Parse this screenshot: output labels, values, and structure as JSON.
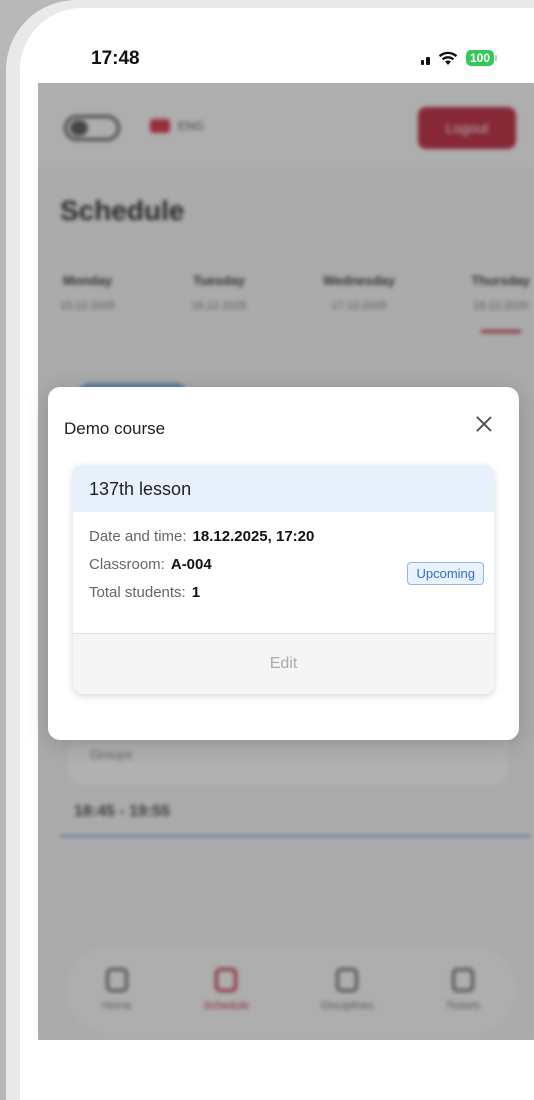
{
  "status_bar": {
    "time": "17:48",
    "battery": "100"
  },
  "background_app": {
    "header": {
      "lang": "ENG",
      "logout_label": "Logout"
    },
    "title": "Schedule",
    "days": [
      {
        "name": "Monday",
        "date": "15.12.2025"
      },
      {
        "name": "Tuesday",
        "date": "16.12.2025"
      },
      {
        "name": "Wednesday",
        "date": "17.12.2025"
      },
      {
        "name": "Thursday",
        "date": "18.12.2025",
        "active": true
      }
    ],
    "group_label": "Groups",
    "time_slot": "18:45 - 19:55",
    "nav": [
      {
        "label": "Home",
        "icon": "home-icon"
      },
      {
        "label": "Schedule",
        "icon": "calendar-icon",
        "active": true
      },
      {
        "label": "Disciplines",
        "icon": "book-icon"
      },
      {
        "label": "Tickets",
        "icon": "ticket-icon"
      }
    ]
  },
  "modal": {
    "title": "Demo course",
    "lesson": {
      "name": "137th lesson",
      "date_label": "Date and time:",
      "date_value": "18.12.2025, 17:20",
      "classroom_label": "Classroom:",
      "classroom_value": "A-004",
      "status": "Upcoming",
      "students_label": "Total students:",
      "students_value": "1",
      "edit_label": "Edit"
    }
  },
  "colors": {
    "accent": "#b8142c",
    "badge": "#2d6fc4",
    "lesson_header": "#e6f1fc",
    "battery": "#34c759"
  }
}
